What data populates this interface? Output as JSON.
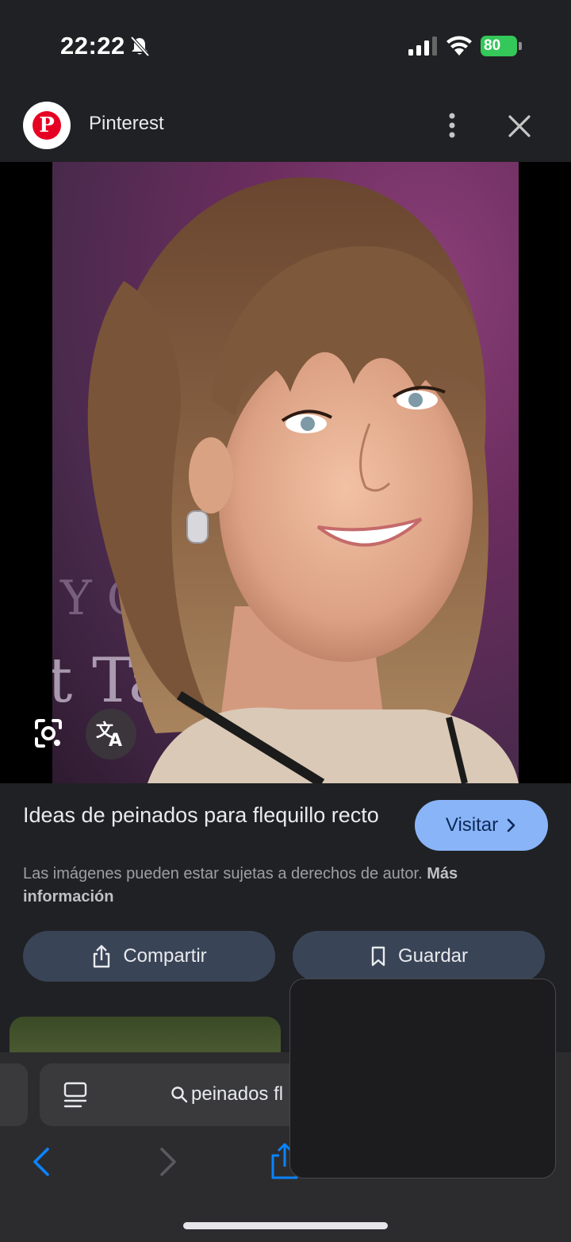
{
  "status_bar": {
    "time": "22:22",
    "battery": "80"
  },
  "header": {
    "source_name": "Pinterest",
    "logo_letter": "P"
  },
  "result": {
    "title": "Ideas de peinados para flequillo recto",
    "visit_label": "Visitar",
    "copyright_text": "Las imágenes pueden estar sujetas a derechos de autor.",
    "copyright_link": "Más información"
  },
  "actions": {
    "share_label": "Compartir",
    "save_label": "Guardar"
  },
  "browser": {
    "url_text": "peinados fl"
  },
  "colors": {
    "visit_button": "#8ab4f8",
    "action_button": "#394457",
    "background": "#202124",
    "toolbar_accent": "#0a84ff"
  }
}
